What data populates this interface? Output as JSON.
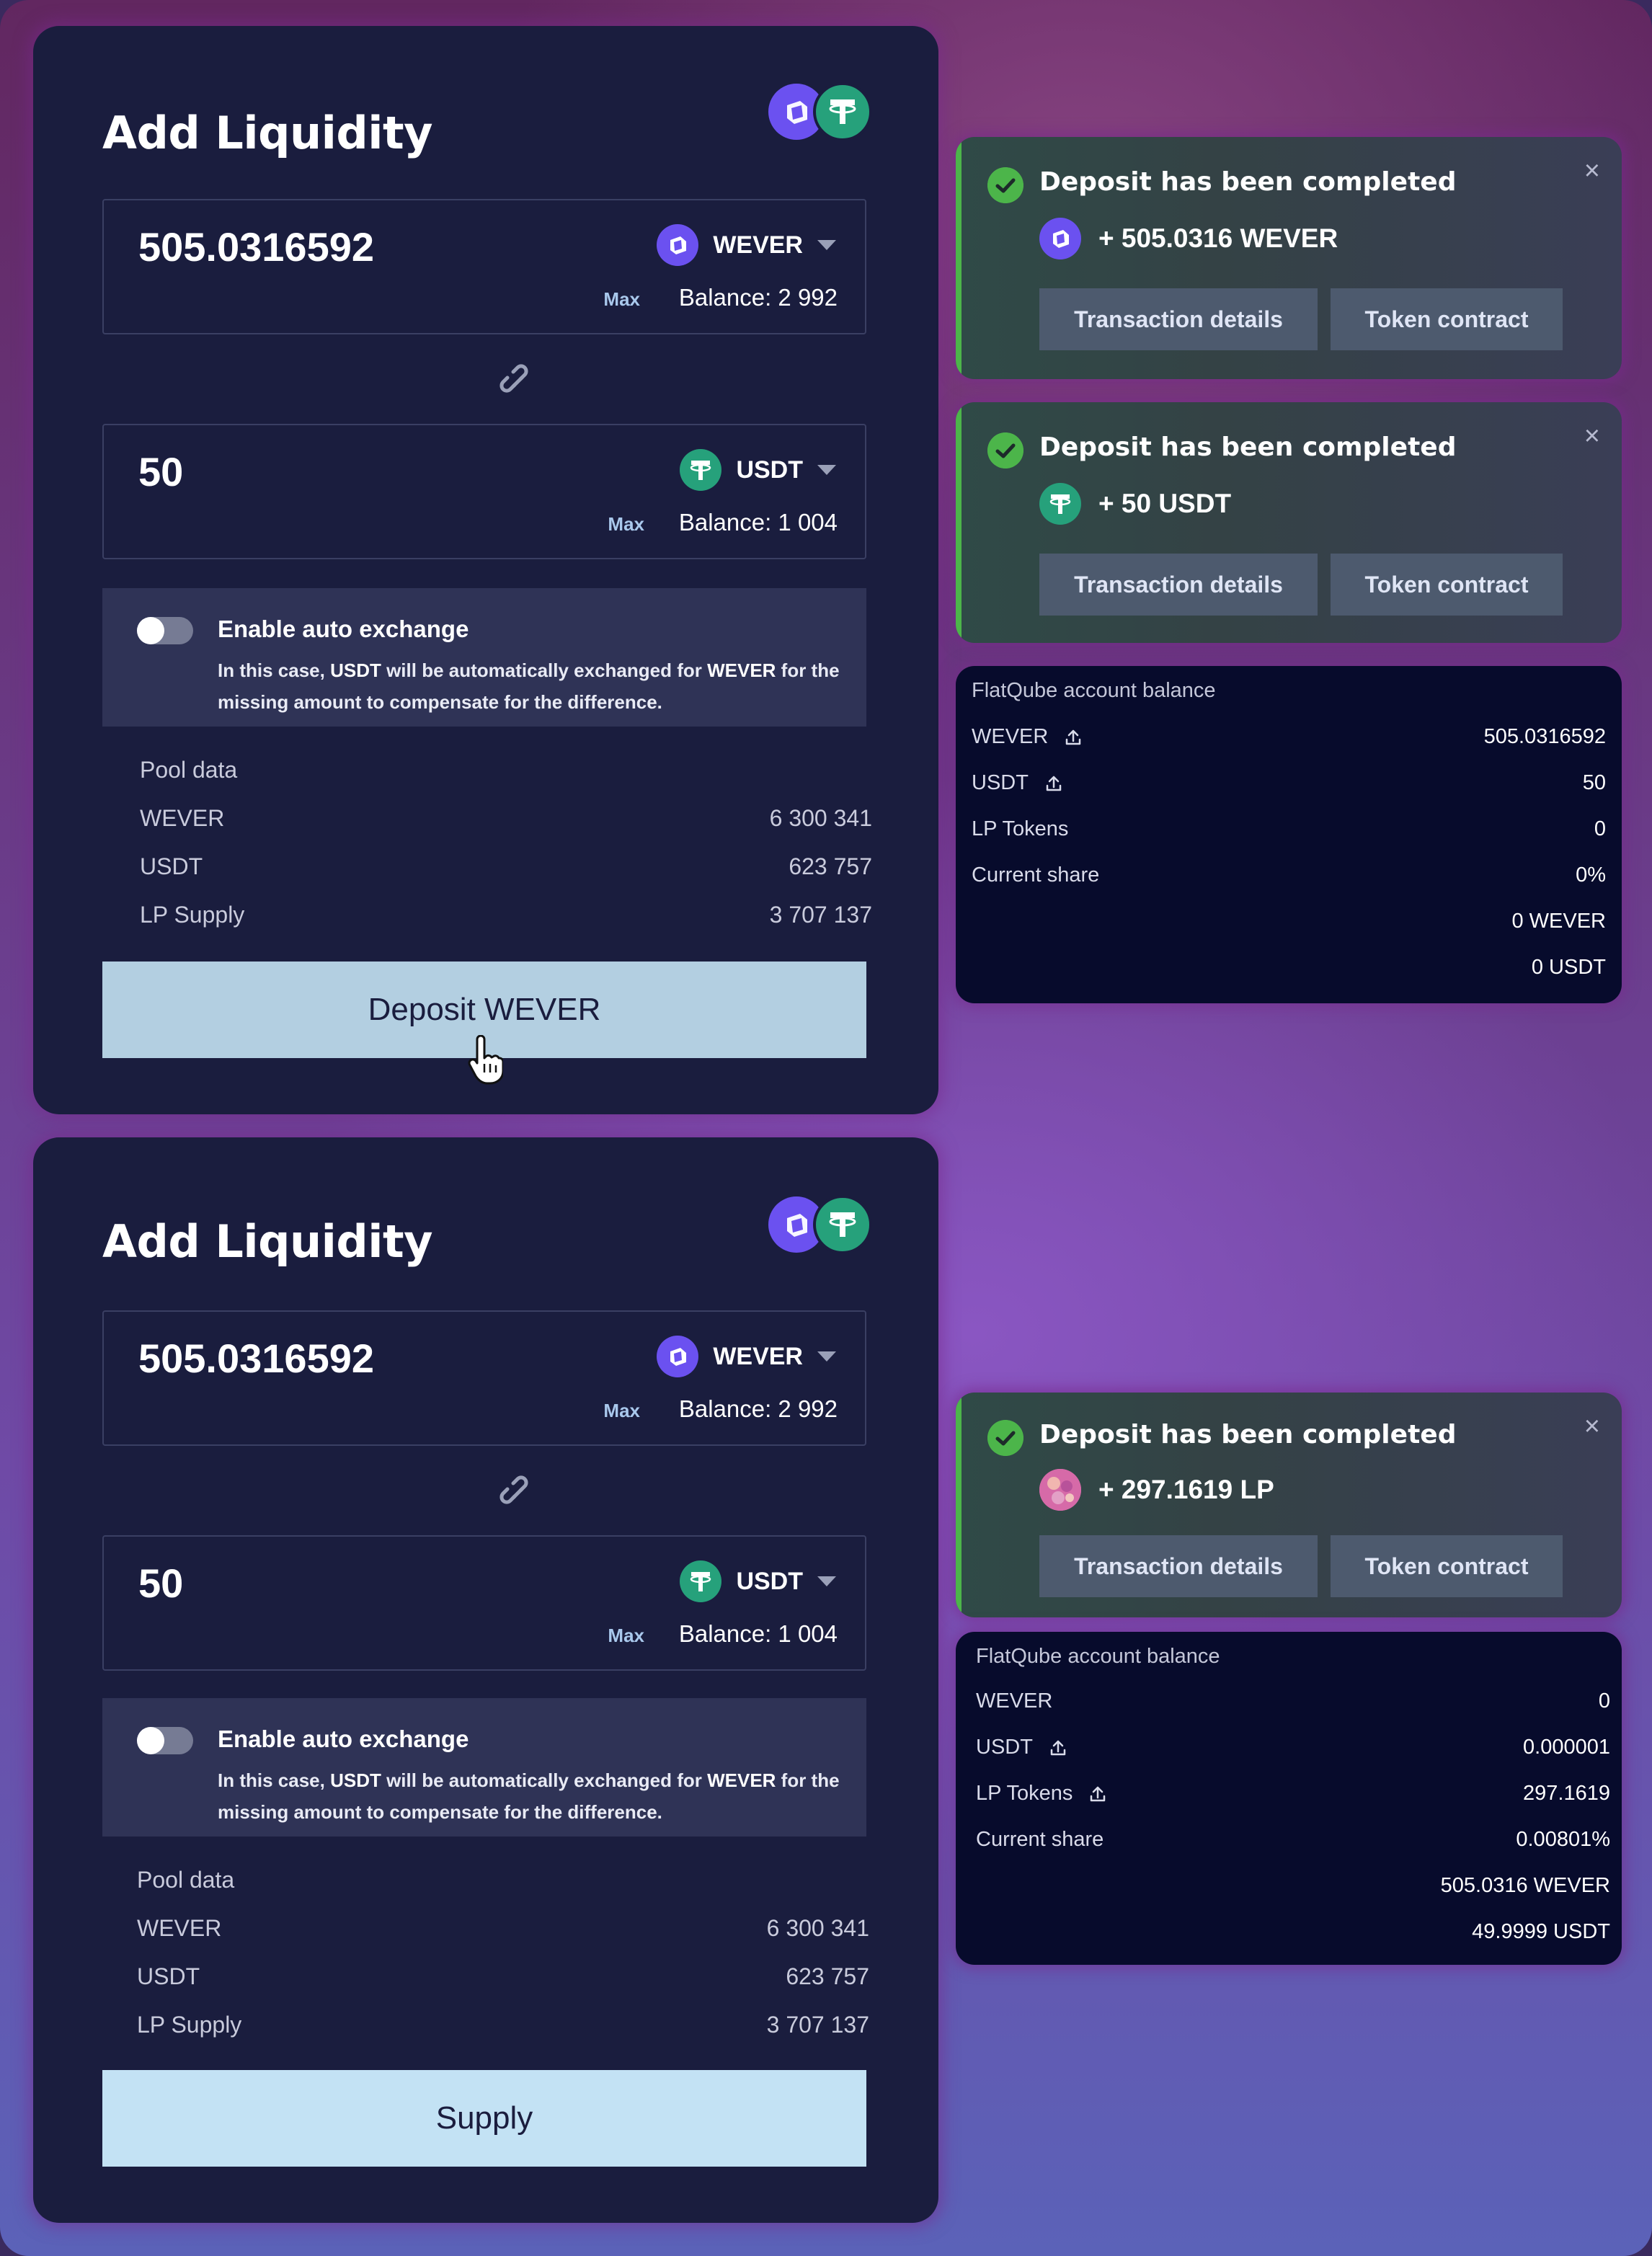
{
  "colors": {
    "card_bg": "#1a1d3e",
    "deposit_button": "#b3cfe1",
    "supply_button": "#c3e2f4",
    "success": "#4cb54a",
    "wever": "#6b51f0",
    "usdt": "#26a17b",
    "lp_token": "#d66aa8"
  },
  "icons": [
    "wever-token-icon",
    "usdt-token-icon",
    "lp-token-icon",
    "link-icon",
    "chevron-down-icon",
    "check-circle-icon",
    "close-icon",
    "upload-icon",
    "hand-pointer-cursor"
  ],
  "cards": [
    {
      "title": "Add Liquidity",
      "token_a": {
        "amount": "505.0316592",
        "symbol": "WEVER",
        "max": "Max",
        "balance": "Balance: 2 992"
      },
      "token_b": {
        "amount": "50",
        "symbol": "USDT",
        "max": "Max",
        "balance": "Balance: 1 004"
      },
      "auto_exchange": {
        "label": "Enable auto exchange",
        "desc_pre": "In this case, ",
        "desc_from": "USDT",
        "desc_mid": " will be automatically exchanged for ",
        "desc_to": "WEVER",
        "desc_post": " for the missing amount to compensate for the difference.",
        "enabled": false
      },
      "pool": {
        "header": "Pool data",
        "rows": [
          {
            "label": "WEVER",
            "value": "6 300 341"
          },
          {
            "label": "USDT",
            "value": "623 757"
          },
          {
            "label": "LP Supply",
            "value": "3 707 137"
          }
        ]
      },
      "button": "Deposit WEVER"
    },
    {
      "title": "Add Liquidity",
      "token_a": {
        "amount": "505.0316592",
        "symbol": "WEVER",
        "max": "Max",
        "balance": "Balance: 2 992"
      },
      "token_b": {
        "amount": "50",
        "symbol": "USDT",
        "max": "Max",
        "balance": "Balance: 1 004"
      },
      "auto_exchange": {
        "label": "Enable auto exchange",
        "desc_pre": "In this case, ",
        "desc_from": "USDT",
        "desc_mid": " will be automatically exchanged for ",
        "desc_to": "WEVER",
        "desc_post": " for the missing amount to compensate for the difference.",
        "enabled": false
      },
      "pool": {
        "header": "Pool data",
        "rows": [
          {
            "label": "WEVER",
            "value": "6 300 341"
          },
          {
            "label": "USDT",
            "value": "623 757"
          },
          {
            "label": "LP Supply",
            "value": "3 707 137"
          }
        ]
      },
      "button": "Supply"
    }
  ],
  "notifications": [
    {
      "title": "Deposit has been completed",
      "amount": "+ 505.0316 WEVER",
      "token": "WEVER",
      "btn_details": "Transaction details",
      "btn_contract": "Token contract",
      "close": "×"
    },
    {
      "title": "Deposit has been completed",
      "amount": "+ 50 USDT",
      "token": "USDT",
      "btn_details": "Transaction details",
      "btn_contract": "Token contract",
      "close": "×"
    },
    {
      "title": "Deposit has been completed",
      "amount": "+ 297.1619 LP",
      "token": "LP",
      "btn_details": "Transaction details",
      "btn_contract": "Token contract",
      "close": "×"
    }
  ],
  "balances": [
    {
      "title": "FlatQube account balance",
      "rows": [
        {
          "label": "WEVER",
          "value": "505.0316592",
          "upload": true
        },
        {
          "label": "USDT",
          "value": "50",
          "upload": true
        },
        {
          "label": "LP Tokens",
          "value": "0",
          "upload": false
        },
        {
          "label": "Current share",
          "value": "0%",
          "upload": false
        },
        {
          "label": "",
          "value": "0 WEVER",
          "upload": false
        },
        {
          "label": "",
          "value": "0 USDT",
          "upload": false
        }
      ]
    },
    {
      "title": "FlatQube account balance",
      "rows": [
        {
          "label": "WEVER",
          "value": "0",
          "upload": false
        },
        {
          "label": "USDT",
          "value": "0.000001",
          "upload": true
        },
        {
          "label": "LP Tokens",
          "value": "297.1619",
          "upload": true
        },
        {
          "label": "Current share",
          "value": "0.00801%",
          "upload": false
        },
        {
          "label": "",
          "value": "505.0316 WEVER",
          "upload": false
        },
        {
          "label": "",
          "value": "49.9999 USDT",
          "upload": false
        }
      ]
    }
  ]
}
